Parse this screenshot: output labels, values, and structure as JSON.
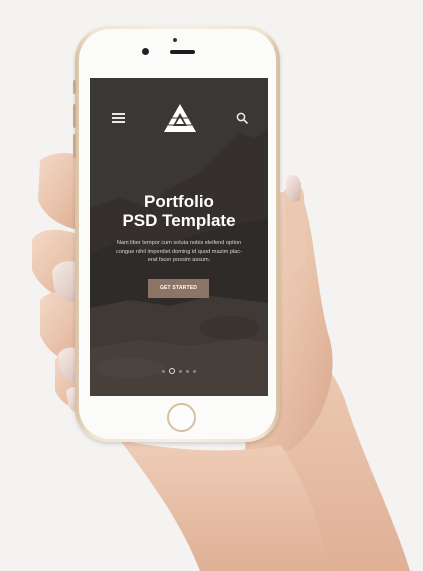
{
  "nav": {
    "menu_icon": "hamburger-menu-icon",
    "logo": "triangle-logo",
    "search_icon": "search-icon"
  },
  "hero": {
    "title_line1": "Portfolio",
    "title_line2": "PSD Template",
    "body_line1": "Nam liber tempor cum soluta nobis eleifend option",
    "body_line2": "congue nihil imperdiet doming id quod mazim plac-",
    "body_line3": "erat facer possim assum.",
    "cta_label": "GET STARTED"
  },
  "pager": {
    "count": 5,
    "active_index": 1
  },
  "colors": {
    "screen_background": "#3a3633",
    "cta_background": "#8c7566",
    "phone_body": "#f1e3d0",
    "page_background": "#f4f3f1"
  }
}
